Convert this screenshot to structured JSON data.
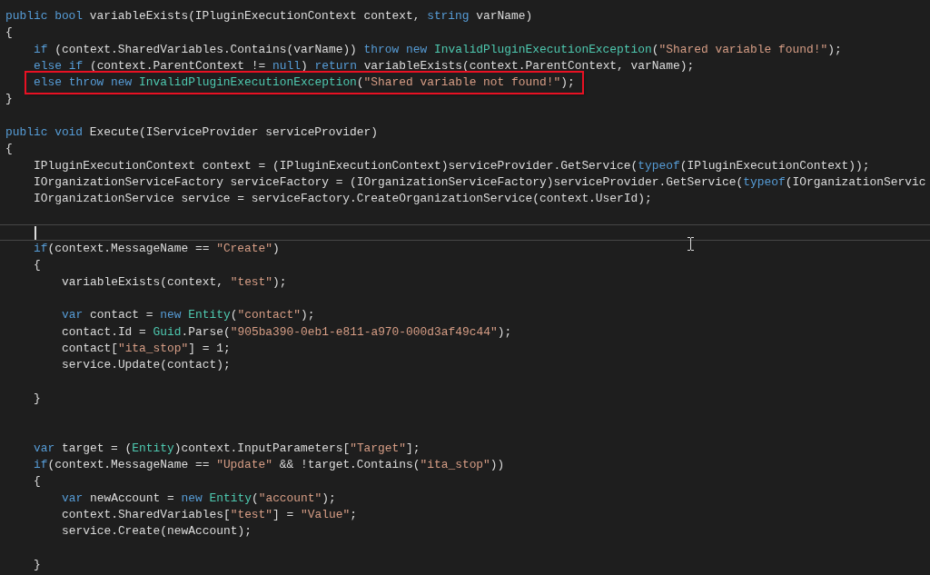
{
  "editor": {
    "lines": [
      {
        "kind": "code",
        "highlighted": false,
        "tokens": [
          {
            "kind": "keyword",
            "text": "public bool"
          },
          {
            "kind": "plain",
            "text": " variableExists(IPluginExecutionContext context, "
          },
          {
            "kind": "keyword",
            "text": "string"
          },
          {
            "kind": "plain",
            "text": " varName)"
          }
        ]
      },
      {
        "kind": "code",
        "highlighted": false,
        "tokens": [
          {
            "kind": "plain",
            "text": "{"
          }
        ],
        "children": [
          {
            "kind": "code",
            "highlighted": false,
            "tokens": [
              {
                "kind": "keyword",
                "text": "if"
              },
              {
                "kind": "plain",
                "text": " (context.SharedVariables.Contains(varName)) "
              },
              {
                "kind": "keyword",
                "text": "throw new "
              },
              {
                "kind": "type",
                "text": "InvalidPluginExecutionException"
              },
              {
                "kind": "plain",
                "text": "("
              },
              {
                "kind": "string",
                "text": "\"Shared variable found!\""
              },
              {
                "kind": "plain",
                "text": ");"
              }
            ]
          },
          {
            "kind": "code",
            "highlighted": false,
            "tokens": [
              {
                "kind": "keyword",
                "text": "else if"
              },
              {
                "kind": "plain",
                "text": " (context.ParentContext != "
              },
              {
                "kind": "keyword",
                "text": "null"
              },
              {
                "kind": "plain",
                "text": ") "
              },
              {
                "kind": "keyword",
                "text": "return"
              },
              {
                "kind": "plain",
                "text": " variableExists(context.ParentContext, varName);"
              }
            ]
          },
          {
            "kind": "code",
            "highlighted": true,
            "tokens": [
              {
                "kind": "keyword",
                "text": "else throw new "
              },
              {
                "kind": "type",
                "text": "InvalidPluginExecutionException"
              },
              {
                "kind": "plain",
                "text": "("
              },
              {
                "kind": "string",
                "text": "\"Shared variable not found!\""
              },
              {
                "kind": "plain",
                "text": ");"
              }
            ]
          }
        ]
      },
      {
        "kind": "code",
        "highlighted": false,
        "tokens": [
          {
            "kind": "plain",
            "text": "}"
          }
        ]
      },
      {
        "kind": "blank",
        "current": false
      },
      {
        "kind": "code",
        "highlighted": false,
        "tokens": [
          {
            "kind": "keyword",
            "text": "public void"
          },
          {
            "kind": "plain",
            "text": " Execute(IServiceProvider serviceProvider)"
          }
        ]
      },
      {
        "kind": "code",
        "highlighted": false,
        "tokens": [
          {
            "kind": "plain",
            "text": "{"
          }
        ],
        "children": [
          {
            "kind": "code",
            "highlighted": false,
            "tokens": [
              {
                "kind": "plain",
                "text": "IPluginExecutionContext context = (IPluginExecutionContext)serviceProvider.GetService("
              },
              {
                "kind": "keyword",
                "text": "typeof"
              },
              {
                "kind": "plain",
                "text": "(IPluginExecutionContext));"
              }
            ]
          },
          {
            "kind": "code",
            "highlighted": false,
            "tokens": [
              {
                "kind": "plain",
                "text": "IOrganizationServiceFactory serviceFactory = (IOrganizationServiceFactory)serviceProvider.GetService("
              },
              {
                "kind": "keyword",
                "text": "typeof"
              },
              {
                "kind": "plain",
                "text": "(IOrganizationServic"
              }
            ]
          },
          {
            "kind": "code",
            "highlighted": false,
            "tokens": [
              {
                "kind": "plain",
                "text": "IOrganizationService service = serviceFactory.CreateOrganizationService(context.UserId);"
              }
            ]
          },
          {
            "kind": "blank",
            "current": false
          },
          {
            "kind": "blank",
            "current": true
          },
          {
            "kind": "code",
            "highlighted": false,
            "tokens": [
              {
                "kind": "keyword",
                "text": "if"
              },
              {
                "kind": "plain",
                "text": "(context.MessageName == "
              },
              {
                "kind": "string",
                "text": "\"Create\""
              },
              {
                "kind": "plain",
                "text": ")"
              }
            ]
          },
          {
            "kind": "code",
            "highlighted": false,
            "tokens": [
              {
                "kind": "plain",
                "text": "{"
              }
            ],
            "children": [
              {
                "kind": "code",
                "highlighted": false,
                "tokens": [
                  {
                    "kind": "plain",
                    "text": "variableExists(context, "
                  },
                  {
                    "kind": "string",
                    "text": "\"test\""
                  },
                  {
                    "kind": "plain",
                    "text": ");"
                  }
                ]
              },
              {
                "kind": "blank",
                "current": false
              },
              {
                "kind": "code",
                "highlighted": false,
                "tokens": [
                  {
                    "kind": "keyword",
                    "text": "var"
                  },
                  {
                    "kind": "plain",
                    "text": " contact = "
                  },
                  {
                    "kind": "keyword",
                    "text": "new "
                  },
                  {
                    "kind": "type",
                    "text": "Entity"
                  },
                  {
                    "kind": "plain",
                    "text": "("
                  },
                  {
                    "kind": "string",
                    "text": "\"contact\""
                  },
                  {
                    "kind": "plain",
                    "text": ");"
                  }
                ]
              },
              {
                "kind": "code",
                "highlighted": false,
                "tokens": [
                  {
                    "kind": "plain",
                    "text": "contact.Id = "
                  },
                  {
                    "kind": "type",
                    "text": "Guid"
                  },
                  {
                    "kind": "plain",
                    "text": ".Parse("
                  },
                  {
                    "kind": "string",
                    "text": "\"905ba390-0eb1-e811-a970-000d3af49c44\""
                  },
                  {
                    "kind": "plain",
                    "text": ");"
                  }
                ]
              },
              {
                "kind": "code",
                "highlighted": false,
                "tokens": [
                  {
                    "kind": "plain",
                    "text": "contact["
                  },
                  {
                    "kind": "string",
                    "text": "\"ita_stop\""
                  },
                  {
                    "kind": "plain",
                    "text": "] = 1;"
                  }
                ]
              },
              {
                "kind": "code",
                "highlighted": false,
                "tokens": [
                  {
                    "kind": "plain",
                    "text": "service.Update(contact);"
                  }
                ]
              },
              {
                "kind": "blank",
                "current": false
              }
            ]
          },
          {
            "kind": "code",
            "highlighted": false,
            "tokens": [
              {
                "kind": "plain",
                "text": "}"
              }
            ]
          },
          {
            "kind": "blank",
            "current": false
          },
          {
            "kind": "blank",
            "current": false
          },
          {
            "kind": "code",
            "highlighted": false,
            "tokens": [
              {
                "kind": "keyword",
                "text": "var"
              },
              {
                "kind": "plain",
                "text": " target = ("
              },
              {
                "kind": "type",
                "text": "Entity"
              },
              {
                "kind": "plain",
                "text": ")context.InputParameters["
              },
              {
                "kind": "string",
                "text": "\"Target\""
              },
              {
                "kind": "plain",
                "text": "];"
              }
            ]
          },
          {
            "kind": "code",
            "highlighted": false,
            "tokens": [
              {
                "kind": "keyword",
                "text": "if"
              },
              {
                "kind": "plain",
                "text": "(context.MessageName == "
              },
              {
                "kind": "string",
                "text": "\"Update\""
              },
              {
                "kind": "plain",
                "text": " && !target.Contains("
              },
              {
                "kind": "string",
                "text": "\"ita_stop\""
              },
              {
                "kind": "plain",
                "text": "))"
              }
            ]
          },
          {
            "kind": "code",
            "highlighted": false,
            "tokens": [
              {
                "kind": "plain",
                "text": "{"
              }
            ],
            "children": [
              {
                "kind": "code",
                "highlighted": false,
                "tokens": [
                  {
                    "kind": "keyword",
                    "text": "var"
                  },
                  {
                    "kind": "plain",
                    "text": " newAccount = "
                  },
                  {
                    "kind": "keyword",
                    "text": "new "
                  },
                  {
                    "kind": "type",
                    "text": "Entity"
                  },
                  {
                    "kind": "plain",
                    "text": "("
                  },
                  {
                    "kind": "string",
                    "text": "\"account\""
                  },
                  {
                    "kind": "plain",
                    "text": ");"
                  }
                ]
              },
              {
                "kind": "code",
                "highlighted": false,
                "tokens": [
                  {
                    "kind": "plain",
                    "text": "context.SharedVariables["
                  },
                  {
                    "kind": "string",
                    "text": "\"test\""
                  },
                  {
                    "kind": "plain",
                    "text": "] = "
                  },
                  {
                    "kind": "string",
                    "text": "\"Value\""
                  },
                  {
                    "kind": "plain",
                    "text": ";"
                  }
                ]
              },
              {
                "kind": "code",
                "highlighted": false,
                "tokens": [
                  {
                    "kind": "plain",
                    "text": "service.Create(newAccount);"
                  }
                ]
              },
              {
                "kind": "blank",
                "current": false
              }
            ]
          },
          {
            "kind": "code",
            "highlighted": false,
            "tokens": [
              {
                "kind": "plain",
                "text": "}"
              }
            ]
          }
        ]
      }
    ]
  }
}
